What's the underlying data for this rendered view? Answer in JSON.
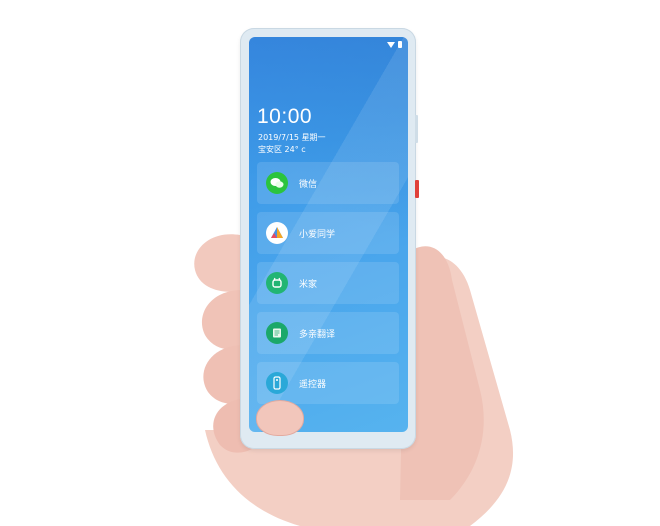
{
  "phone": {
    "status_bar": {
      "wifi_icon": "wifi-icon",
      "battery_icon": "battery-icon"
    },
    "clock": {
      "time": "10:00",
      "date": "2019/7/15 星期一",
      "weather": "宝安区 24° c"
    },
    "apps": [
      {
        "label": "微信",
        "icon": "wechat-icon",
        "color": "#2bc43e"
      },
      {
        "label": "小爱同学",
        "icon": "xiaoai-icon",
        "color": "#ffffff"
      },
      {
        "label": "米家",
        "icon": "mijia-icon",
        "color": "#22b573"
      },
      {
        "label": "多亲翻译",
        "icon": "translate-icon",
        "color": "#1ba86a"
      },
      {
        "label": "遥控器",
        "icon": "remote-icon",
        "color": "#2aa8d8"
      }
    ]
  },
  "colors": {
    "screen_top": "#3a8fe6",
    "screen_bottom": "#56b3ef",
    "side_button": "#e0413a",
    "skin": "#f2c6bb"
  }
}
